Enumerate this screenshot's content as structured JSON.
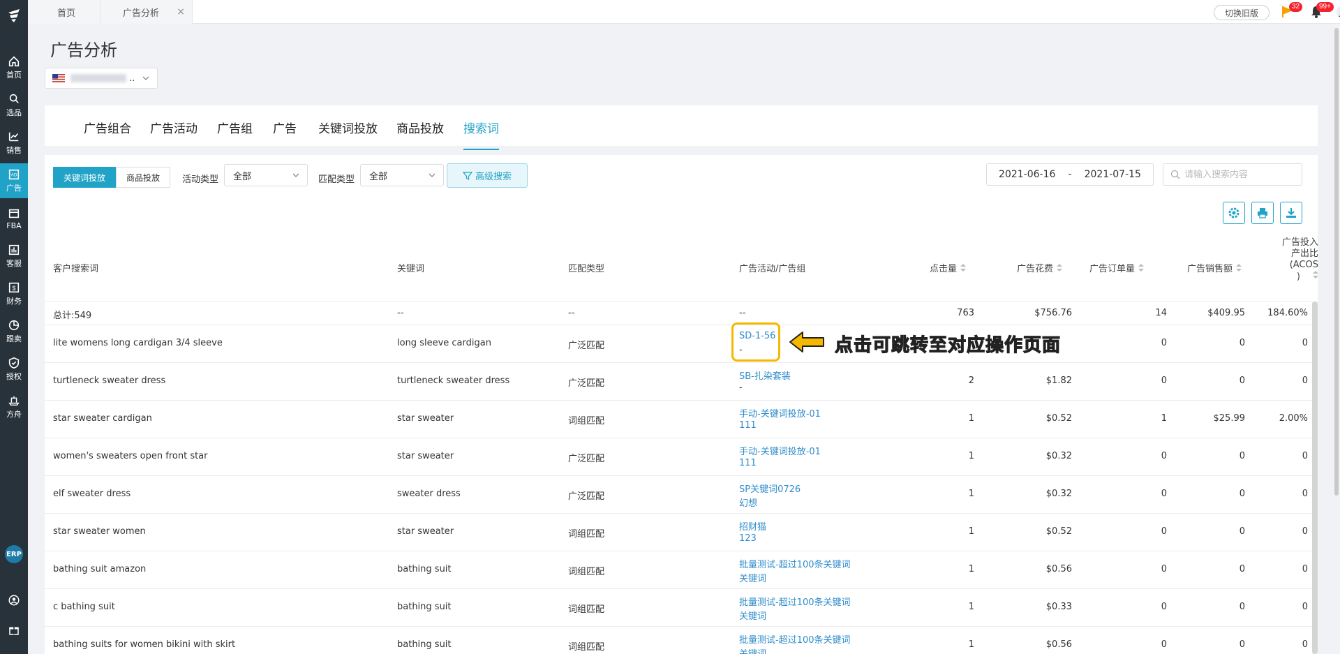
{
  "sidebar": {
    "items": [
      {
        "label": "首页",
        "icon": "home-icon"
      },
      {
        "label": "选品",
        "icon": "search-icon"
      },
      {
        "label": "销售",
        "icon": "chart-icon"
      },
      {
        "label": "广告",
        "icon": "ad-icon",
        "active": true
      },
      {
        "label": "FBA",
        "icon": "box-icon"
      },
      {
        "label": "客服",
        "icon": "report-icon"
      },
      {
        "label": "财务",
        "icon": "dollar-icon"
      },
      {
        "label": "跟卖",
        "icon": "pie-icon"
      },
      {
        "label": "授权",
        "icon": "shield-icon"
      },
      {
        "label": "方舟",
        "icon": "ark-icon"
      }
    ],
    "erp_label": "ERP"
  },
  "topbar": {
    "tabs": [
      {
        "label": "首页"
      },
      {
        "label": "广告分析",
        "closable": true
      }
    ],
    "switch_label": "切换旧版",
    "flag_badge": "32",
    "bell_badge": "99+"
  },
  "page": {
    "title": "广告分析",
    "store_suffix": ".."
  },
  "main_tabs": [
    {
      "label": "广告组合"
    },
    {
      "label": "广告活动"
    },
    {
      "label": "广告组"
    },
    {
      "label": "广告"
    },
    {
      "label": "关键词投放"
    },
    {
      "label": "商品投放"
    },
    {
      "label": "搜索词",
      "active": true
    }
  ],
  "filters": {
    "seg_keyword": "关键词投放",
    "seg_product": "商品投放",
    "campaign_type_label": "活动类型",
    "campaign_type_value": "全部",
    "match_type_label": "匹配类型",
    "match_type_value": "全部",
    "advanced_search": "高级搜索",
    "date_start": "2021-06-16",
    "date_sep": "-",
    "date_end": "2021-07-15",
    "search_placeholder": "请输入搜索内容"
  },
  "table": {
    "headers": {
      "search_term": "客户搜索词",
      "keyword": "关键词",
      "match_type": "匹配类型",
      "campaign_group": "广告活动/广告组",
      "clicks": "点击量",
      "spend": "广告花费",
      "orders": "广告订单量",
      "sales": "广告销售额",
      "acos_line1": "广告投入",
      "acos_line2": "产出比",
      "acos_line3": "(ACOS",
      "acos_line4": ")"
    },
    "total": {
      "label": "总计:549",
      "keyword": "--",
      "match": "--",
      "campaign": "--",
      "clicks": "763",
      "spend": "$756.76",
      "orders": "14",
      "sales": "$409.95",
      "acos": "184.60%"
    },
    "rows": [
      {
        "term": "lite womens long cardigan 3/4 sleeve",
        "keyword": "long sleeve cardigan",
        "match": "广泛匹配",
        "campaign": "SD-1-56",
        "group": "-",
        "clicks": "",
        "spend": "",
        "orders": "0",
        "sales": "0",
        "acos": "0"
      },
      {
        "term": "turtleneck sweater dress",
        "keyword": "turtleneck sweater dress",
        "match": "广泛匹配",
        "campaign": "SB-扎染套装",
        "group": "-",
        "clicks": "2",
        "spend": "$1.82",
        "orders": "0",
        "sales": "0",
        "acos": "0"
      },
      {
        "term": "star sweater cardigan",
        "keyword": "star sweater",
        "match": "词组匹配",
        "campaign": "手动-关键词投放-01",
        "group": "111",
        "clicks": "1",
        "spend": "$0.52",
        "orders": "1",
        "sales": "$25.99",
        "acos": "2.00%"
      },
      {
        "term": "women's sweaters open front star",
        "keyword": "star sweater",
        "match": "广泛匹配",
        "campaign": "手动-关键词投放-01",
        "group": "111",
        "clicks": "1",
        "spend": "$0.32",
        "orders": "0",
        "sales": "0",
        "acos": "0"
      },
      {
        "term": "elf sweater dress",
        "keyword": "sweater dress",
        "match": "广泛匹配",
        "campaign": "SP关键词0726",
        "group": "幻想",
        "clicks": "1",
        "spend": "$0.32",
        "orders": "0",
        "sales": "0",
        "acos": "0"
      },
      {
        "term": "star sweater women",
        "keyword": "star sweater",
        "match": "词组匹配",
        "campaign": "招财猫",
        "group": "123",
        "clicks": "1",
        "spend": "$0.52",
        "orders": "0",
        "sales": "0",
        "acos": "0"
      },
      {
        "term": "bathing suit amazon",
        "keyword": "bathing suit",
        "match": "词组匹配",
        "campaign": "批量测试-超过100条关键词",
        "group": "关键词",
        "clicks": "1",
        "spend": "$0.56",
        "orders": "0",
        "sales": "0",
        "acos": "0"
      },
      {
        "term": "c bathing suit",
        "keyword": "bathing suit",
        "match": "词组匹配",
        "campaign": "批量测试-超过100条关键词",
        "group": "关键词",
        "clicks": "1",
        "spend": "$0.33",
        "orders": "0",
        "sales": "0",
        "acos": "0"
      },
      {
        "term": "bathing suits for women bikini with skirt",
        "keyword": "bathing suit",
        "match": "词组匹配",
        "campaign": "批量测试-超过100条关键词",
        "group": "关键词",
        "clicks": "1",
        "spend": "$0.56",
        "orders": "0",
        "sales": "0",
        "acos": "0"
      }
    ]
  },
  "annotation": {
    "text": "点击可跳转至对应操作页面"
  },
  "colors": {
    "accent": "#21a3c8",
    "link": "#2f8ccc",
    "sidebar": "#27323b",
    "highlight": "#f5b800"
  }
}
